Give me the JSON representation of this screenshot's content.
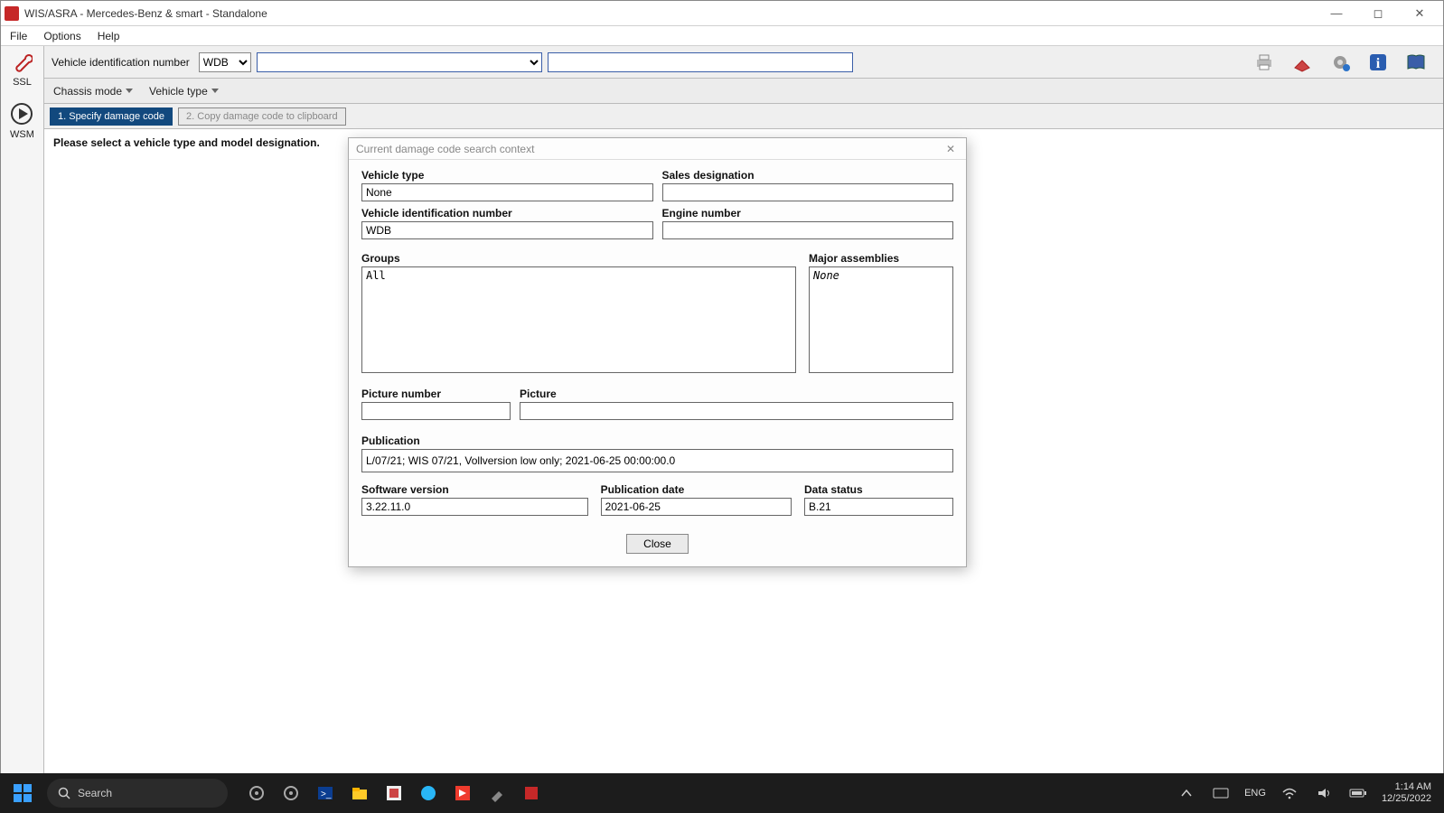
{
  "window": {
    "title": "WIS/ASRA - Mercedes-Benz & smart - Standalone"
  },
  "menu": {
    "file": "File",
    "options": "Options",
    "help": "Help"
  },
  "vinbar": {
    "label": "Vehicle identification number",
    "wdb": "WDB",
    "icons": {
      "print": "print-icon",
      "erase": "eraser-icon",
      "gear": "gear-icon",
      "info": "info-icon",
      "book": "book-icon"
    }
  },
  "chassisbar": {
    "mode": "Chassis mode",
    "type": "Vehicle type"
  },
  "steps": {
    "one": "1. Specify damage code",
    "two": "2. Copy damage code to clipboard"
  },
  "instruction": "Please select a vehicle type and model designation.",
  "leftrail": {
    "ssl": "SSL",
    "wsm": "WSM"
  },
  "dialog": {
    "title": "Current damage code search context",
    "labels": {
      "vehicle_type": "Vehicle type",
      "sales_designation": "Sales designation",
      "vin": "Vehicle identification number",
      "engine_number": "Engine number",
      "groups": "Groups",
      "major_assemblies": "Major assemblies",
      "picture_number": "Picture number",
      "picture": "Picture",
      "publication": "Publication",
      "software_version": "Software version",
      "publication_date": "Publication date",
      "data_status": "Data status"
    },
    "values": {
      "vehicle_type": "None",
      "sales_designation": "",
      "vin": "WDB",
      "engine_number": "",
      "groups": "All",
      "major_assemblies": "None",
      "picture_number": "",
      "picture": "",
      "publication": "L/07/21; WIS 07/21, Vollversion low only; 2021-06-25 00:00:00.0",
      "software_version": "3.22.11.0",
      "publication_date": "2021-06-25",
      "data_status": "B.21"
    },
    "close": "Close"
  },
  "taskbar": {
    "search_placeholder": "Search",
    "lang": "ENG",
    "time": "1:14 AM",
    "date": "12/25/2022"
  }
}
